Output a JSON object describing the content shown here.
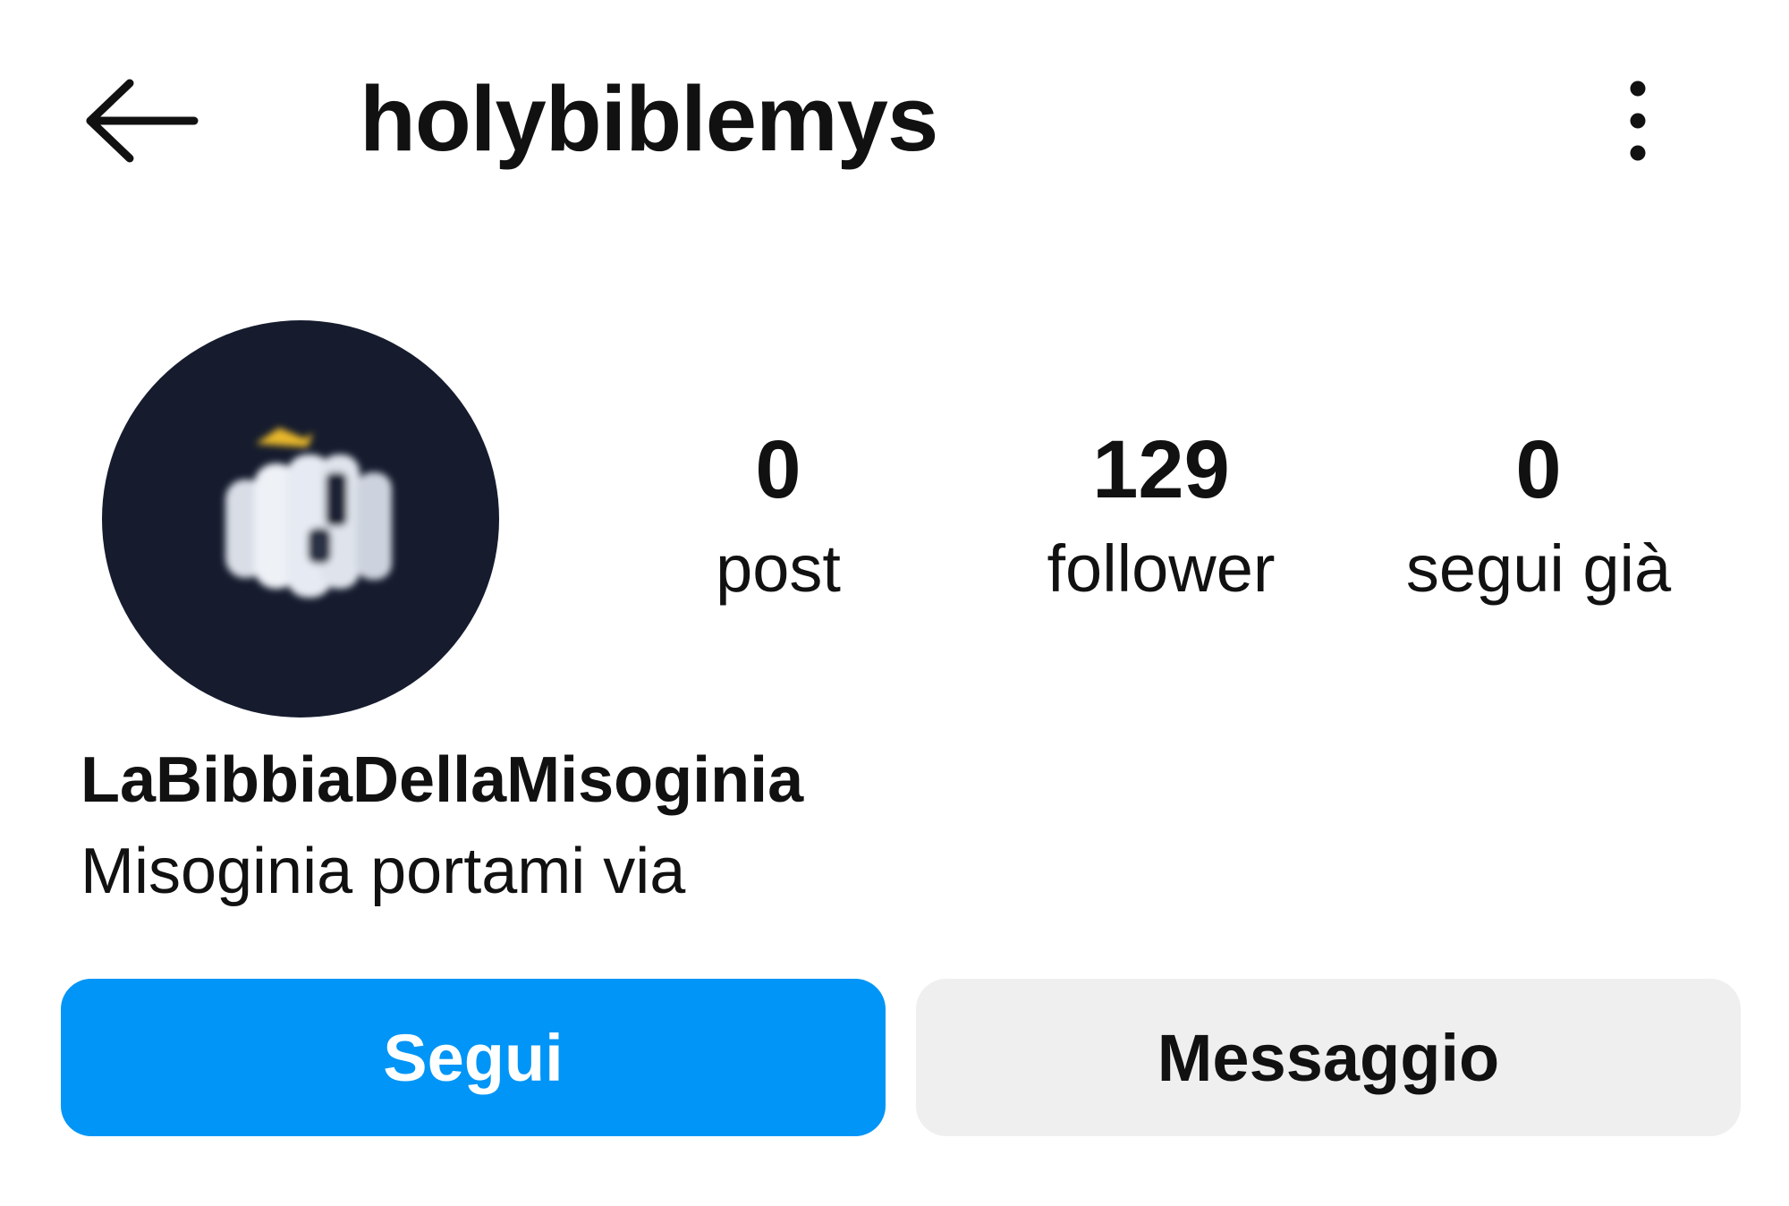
{
  "header": {
    "back_icon": "arrow-left-icon",
    "username": "holybiblemys",
    "more_icon": "more-vertical-icon"
  },
  "profile": {
    "avatar_icon": "profile-picture",
    "avatar_bg_color": "#161c2e",
    "stats": {
      "posts": {
        "value": "0",
        "label": "post"
      },
      "followers": {
        "value": "129",
        "label": "follower"
      },
      "following": {
        "value": "0",
        "label": "segui già"
      }
    },
    "display_name": "LaBibbiaDellaMisoginia",
    "bio": "Misoginia portami via"
  },
  "actions": {
    "follow_label": "Segui",
    "follow_color": "#0095f6",
    "message_label": "Messaggio",
    "message_color": "#efefef"
  }
}
